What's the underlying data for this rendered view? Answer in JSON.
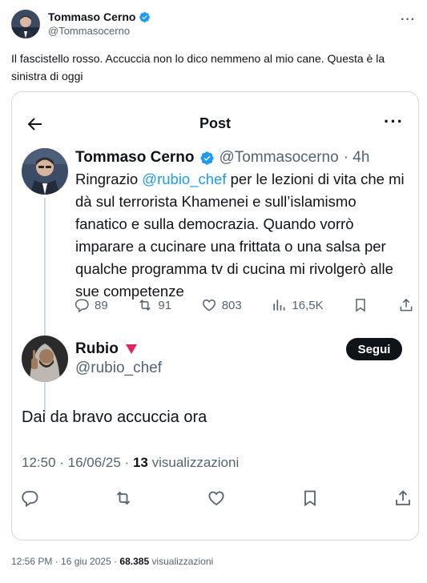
{
  "tweet": {
    "author_name": "Tommaso Cerno",
    "author_handle": "@Tommasocerno",
    "text": "Il fascistello rosso. Accuccia non lo dico nemmeno al mio cane. Questa è la sinistra di oggi",
    "time": "12:56 PM · 16 giu 2025 · ",
    "views": "68.385",
    "views_label": " visualizzazioni"
  },
  "embed": {
    "header_title": "Post",
    "quoted": {
      "author_name": "Tommaso Cerno",
      "author_handle": "@Tommasocerno",
      "age": "· 4h",
      "text_before": "Ringrazio ",
      "mention": "@rubio_chef",
      "text_after": " per le lezioni di vita che mi dà sul terrorista Khamenei e sull’islamismo fanatico e sulla democrazia. Quando vorrò imparare a cucinare una frittata o una salsa per qualche programma tv di cucina mi rivolgerò alle sue competenze",
      "replies": "89",
      "reposts": "91",
      "likes": "803",
      "views": "16,5K"
    },
    "reply": {
      "author_name": "Rubio",
      "author_handle": "@rubio_chef",
      "follow_label": "Segui",
      "text": "Dai da bravo accuccia ora",
      "time": "12:50 · 16/06/25 · ",
      "views": "13",
      "views_label": " visualizzazioni"
    }
  },
  "colors": {
    "accent": "#1d9bf0",
    "muted": "#536471",
    "text": "#0f1419",
    "border": "#cfd9de",
    "red_triangle": "#e0245e"
  },
  "icons": [
    "verified-badge-icon",
    "more-icon",
    "back-arrow-icon",
    "reply-icon",
    "repost-icon",
    "like-icon",
    "views-icon",
    "bookmark-icon",
    "share-icon",
    "red-triangle-icon"
  ]
}
